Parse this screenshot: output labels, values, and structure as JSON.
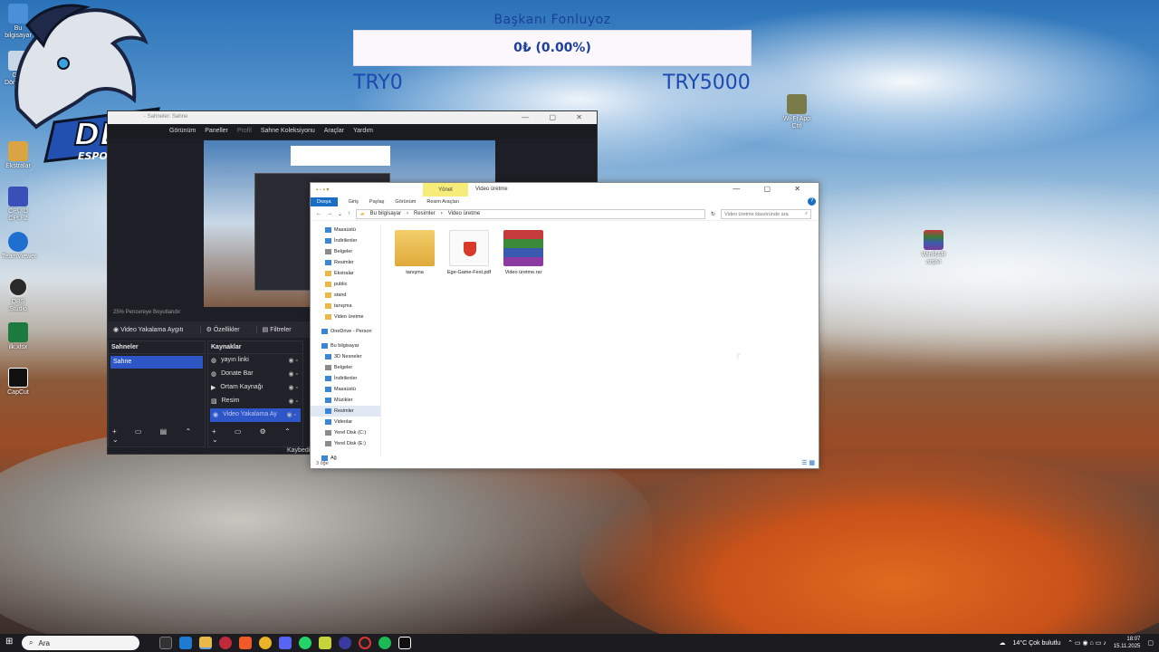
{
  "desktop": {
    "icons": [
      {
        "label": "Bu bilgisayar",
        "color": "#4a90d9"
      },
      {
        "label": "Geri Dönüşüm",
        "color": "#c8d6e6"
      },
      {
        "label": "Ekstralar",
        "color": "#d9a441"
      },
      {
        "label": "CPUID CPU-Z",
        "color": "#3b4fb8"
      },
      {
        "label": "TeamViewer",
        "color": "#1f6fd1"
      },
      {
        "label": "OBS Studio",
        "color": "#2a2a2a"
      },
      {
        "label": "ilk.xlsx",
        "color": "#1d7a3f"
      },
      {
        "label": "CapCut",
        "color": "#111111"
      },
      {
        "label": "WinRAR arşivi",
        "color": "#6a3a8a"
      },
      {
        "label": "Wi-Fi App Ctrl",
        "color": "#7a7a4a"
      }
    ]
  },
  "logo": {
    "text": "DEU",
    "subtext": "ESPOR"
  },
  "donation": {
    "title": "Başkanı Fonluyoz",
    "amount": "0₺ (0.00%)",
    "progress_percent": 0,
    "min_label": "TRY0",
    "max_label": "TRY5000"
  },
  "obs": {
    "window_title": "- Sahneler: Sahne",
    "menu": [
      "Görünüm",
      "Paneller",
      "Profil",
      "Sahne Koleksiyonu",
      "Araçlar",
      "Yardım"
    ],
    "zoom_text": "25%   Pencereye Boyutlandır",
    "context": {
      "source": "Video Yakalama Aygıtı",
      "properties": "Özellikler",
      "filters": "Filtreler"
    },
    "scenes_header": "Sahneler",
    "scenes": [
      "Sahne"
    ],
    "sources_header": "Kaynaklar",
    "sources": [
      "yayın linki",
      "Donate Bar",
      "Ortam Kaynağı",
      "Resim",
      "Video Yakalama Ay"
    ],
    "selected_source": "Video Yakalama Ay",
    "footer_text": "Kaybedil"
  },
  "explorer": {
    "window_title": "Video üretme",
    "manage_tab": "Yönet",
    "ribbon_tabs": [
      "Dosya",
      "Giriş",
      "Paylaş",
      "Görünüm",
      "Resim Araçları"
    ],
    "breadcrumb": [
      "Bu bilgisayar",
      "Resimler",
      "Video üretme"
    ],
    "search_placeholder": "Video üretme klasöründe ara",
    "nav": [
      "Masaüstü",
      "İndirilenler",
      "Belgeler",
      "Resimler",
      "Ekstralar",
      "public",
      "stand",
      "tanışma",
      "Video üretme",
      "OneDrive - Person",
      "Bu bilgisayar",
      "3D Nesneler",
      "Belgeler",
      "İndirilenler",
      "Masaüstü",
      "Müzikler",
      "Resimler",
      "Videolar",
      "Yerel Disk (C:)",
      "Yerel Disk (E:)",
      "Ağ"
    ],
    "files": [
      {
        "name": "tanışma",
        "type": "folder"
      },
      {
        "name": "Ege-Game-Fest.pdf",
        "type": "pdf"
      },
      {
        "name": "Video üretme.rar",
        "type": "rar"
      }
    ],
    "status": "3 öğe"
  },
  "taskbar": {
    "search_placeholder": "Ara",
    "weather": "14°C  Çok bulutlu",
    "time": "18:07",
    "date": "15.11.2025"
  }
}
